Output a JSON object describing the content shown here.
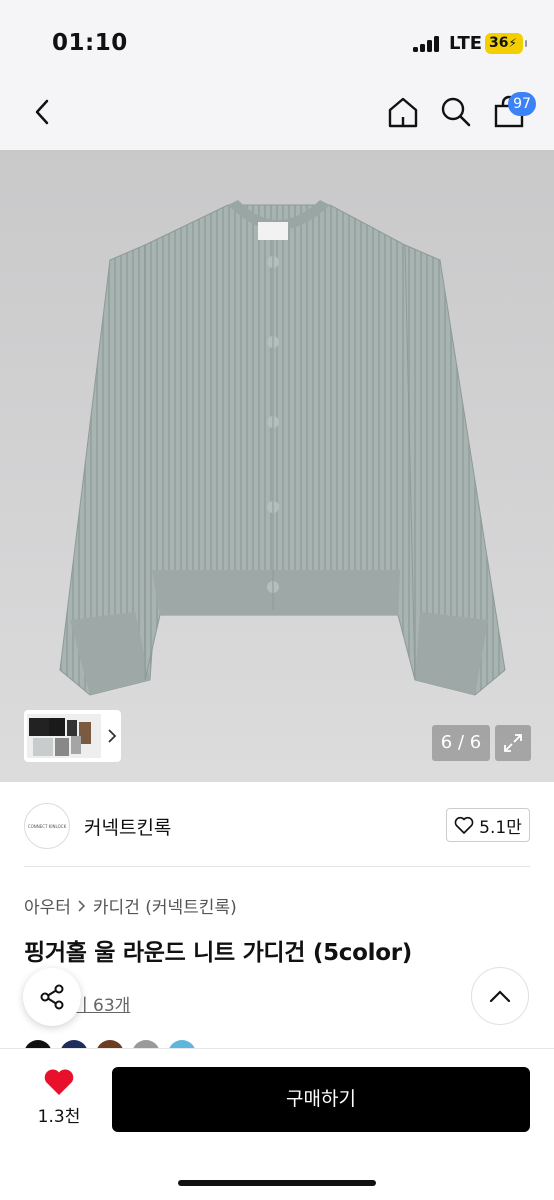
{
  "status": {
    "time": "01:10",
    "network": "LTE",
    "battery": "36"
  },
  "nav": {
    "cart_count": "97"
  },
  "gallery": {
    "counter": "6 / 6"
  },
  "brand": {
    "logo_text": "CONNECT KINLOCK",
    "name": "커넥트킨록",
    "likes": "5.1만"
  },
  "breadcrumb": {
    "level1": "아우터",
    "level2": "카디건 (커넥트킨록)"
  },
  "product": {
    "title": "핑거홀 울 라운드 니트 가디건 (5color)",
    "review_text": "기 63개"
  },
  "swatches": [
    "#111111",
    "#1f2d5c",
    "#6b3d22",
    "#9a9a9a",
    "#5eb6dc"
  ],
  "bottom": {
    "wish_count": "1.3천",
    "buy_label": "구매하기"
  },
  "colors": {
    "accent": "#3b82f6",
    "heart": "#e8102a",
    "buy": "#000000"
  }
}
